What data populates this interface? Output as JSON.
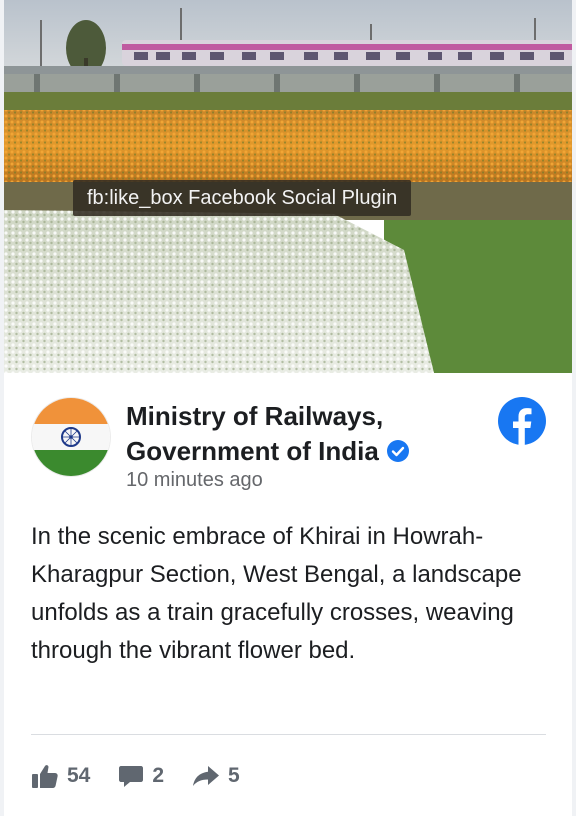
{
  "tooltip": {
    "text": "fb:like_box Facebook Social Plugin"
  },
  "post": {
    "page_name": "Ministry of Railways, Government of India",
    "verified": true,
    "timestamp": "10 minutes ago",
    "message": "In the scenic embrace of Khirai in Howrah-Kharagpur Section, West Bengal, a landscape unfolds as a train gracefully crosses, weaving through the vibrant flower bed."
  },
  "actions": {
    "likes": "54",
    "comments": "2",
    "shares": "5"
  },
  "colors": {
    "facebook_blue": "#1877f2",
    "count_gray": "#606770",
    "timestamp_gray": "#65676b",
    "saffron": "#f0923a",
    "india_green": "#3b8a2e"
  },
  "icons": {
    "platform": "facebook-logo-icon",
    "verified": "verified-badge-icon",
    "like": "thumbs-up-icon",
    "comment": "comment-icon",
    "share": "share-arrow-icon"
  }
}
